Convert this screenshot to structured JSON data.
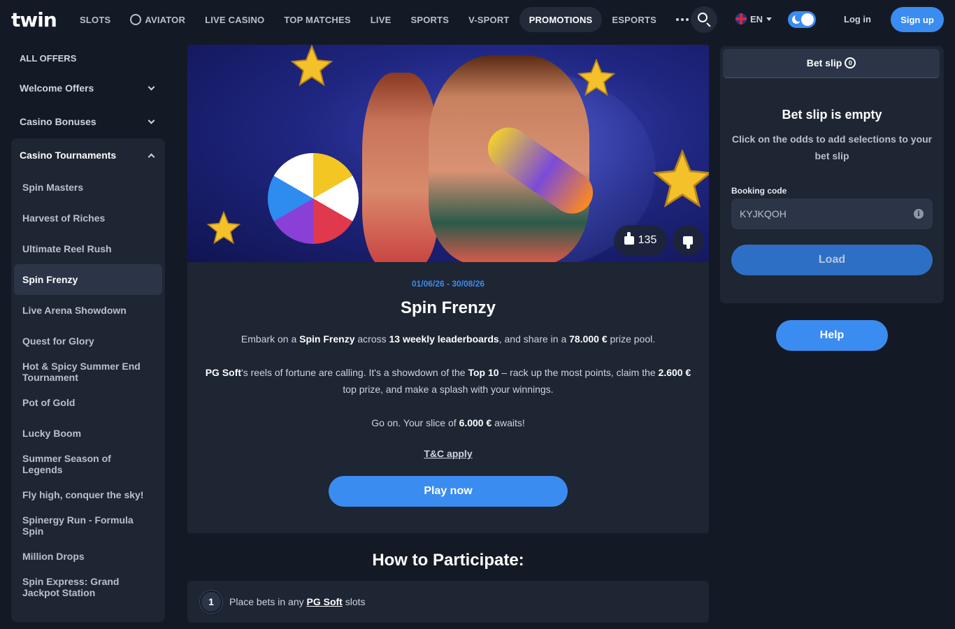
{
  "header": {
    "logo": "twin",
    "nav": [
      "SLOTS",
      "AVIATOR",
      "LIVE CASINO",
      "TOP MATCHES",
      "LIVE",
      "SPORTS",
      "V-SPORT",
      "PROMOTIONS",
      "ESPORTS"
    ],
    "active_nav": "PROMOTIONS",
    "language": "EN",
    "login_label": "Log in",
    "signup_label": "Sign up"
  },
  "sidebar": {
    "all_offers": "ALL OFFERS",
    "groups": [
      {
        "label": "Welcome Offers",
        "expanded": false
      },
      {
        "label": "Casino Bonuses",
        "expanded": false
      }
    ],
    "open_group": {
      "label": "Casino Tournaments",
      "items": [
        "Spin Masters",
        "Harvest of Riches",
        "Ultimate Reel Rush",
        "Spin Frenzy",
        "Live Arena Showdown",
        "Quest for Glory",
        "Hot & Spicy Summer End Tournament",
        "Pot of Gold",
        "Lucky Boom",
        "Summer Season of Legends",
        "Fly high, conquer the sky!",
        "Spinergy Run - Formula Spin",
        "Million Drops",
        "Spin Express: Grand Jackpot Station"
      ],
      "active_item": "Spin Frenzy"
    }
  },
  "promo": {
    "likes": "135",
    "dates": "01/06/26 - 30/08/26",
    "title": "Spin Frenzy",
    "p1": {
      "a": "Embark on a ",
      "b": "Spin Frenzy",
      "c": " across ",
      "d": "13 weekly leaderboards",
      "e": ", and share in a ",
      "f": "78.000 €",
      "g": " prize pool."
    },
    "p2": {
      "a": "PG Soft",
      "b": "'s reels of fortune are calling. It's a showdown of the ",
      "c": "Top 10",
      "d": " – rack up the most points, claim the ",
      "e": "2.600 €",
      "f": " top prize, and make a splash with your winnings."
    },
    "p3": {
      "a": "Go on. Your slice of ",
      "b": "6.000 €",
      "c": " awaits!"
    },
    "tc_label": "T&C apply",
    "play_label": "Play now"
  },
  "howto": {
    "title": "How to Participate:",
    "steps": [
      {
        "num": "1",
        "pre": "Place bets in any ",
        "link": "PG Soft",
        "post": " slots"
      }
    ]
  },
  "betslip": {
    "tab_label": "Bet slip",
    "count": "0",
    "empty_title": "Bet slip is empty",
    "empty_hint": "Click on the odds to add selections to your bet slip",
    "booking_label": "Booking code",
    "booking_value": "KYJKQOH",
    "load_label": "Load",
    "help_label": "Help"
  },
  "colors": {
    "background": "#141a25",
    "panel": "#1e2533",
    "accent": "#3b8cf0"
  }
}
